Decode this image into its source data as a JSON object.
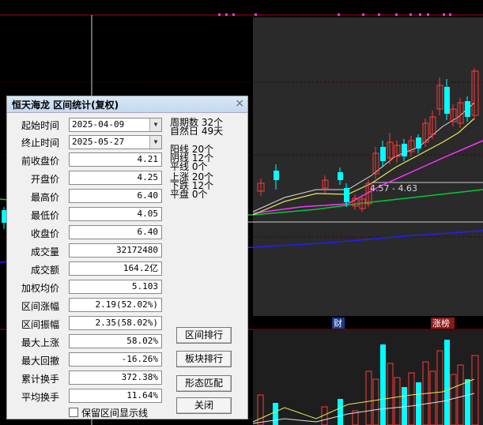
{
  "chart": {
    "range_label": "4.57 - 4.63",
    "marker_cai": "财",
    "marker_zhangbang": "涨榜"
  },
  "dialog": {
    "title": "恒天海龙 区间统计(复权)",
    "close_icon": "×",
    "start_label": "起始时间",
    "start_value": "2025-04-09",
    "end_label": "终止时间",
    "end_value": "2025-05-27",
    "dropdown_icon": "▼",
    "fields": [
      {
        "label": "前收盘价",
        "value": "4.21"
      },
      {
        "label": "开盘价",
        "value": "4.25"
      },
      {
        "label": "最高价",
        "value": "6.40"
      },
      {
        "label": "最低价",
        "value": "4.05"
      },
      {
        "label": "收盘价",
        "value": "6.40"
      },
      {
        "label": "成交量",
        "value": "32172480"
      },
      {
        "label": "成交额",
        "value": "164.2亿"
      },
      {
        "label": "加权均价",
        "value": "5.103"
      },
      {
        "label": "区间涨幅",
        "value": "2.19(52.02%)"
      },
      {
        "label": "区间振幅",
        "value": "2.35(58.02%)"
      },
      {
        "label": "最大上涨",
        "value": "58.02%"
      },
      {
        "label": "最大回撤",
        "value": "-16.26%"
      },
      {
        "label": "累计换手",
        "value": "372.38%"
      },
      {
        "label": "平均换手",
        "value": "11.64%"
      }
    ],
    "info": {
      "weeks": "周期数 32个",
      "days": "自然日 49天",
      "yang": "阳线 20个",
      "yin": "阴线 12个",
      "flat": "平线 0个",
      "up": "上涨 20个",
      "down": "下跌 12个",
      "even": "平盘 0个"
    },
    "buttons": {
      "range_rank": "区间排行",
      "sector_rank": "板块排行",
      "pattern_match": "形态匹配",
      "close": "关闭"
    },
    "keep_lines_label": "保留区间显示线"
  }
}
